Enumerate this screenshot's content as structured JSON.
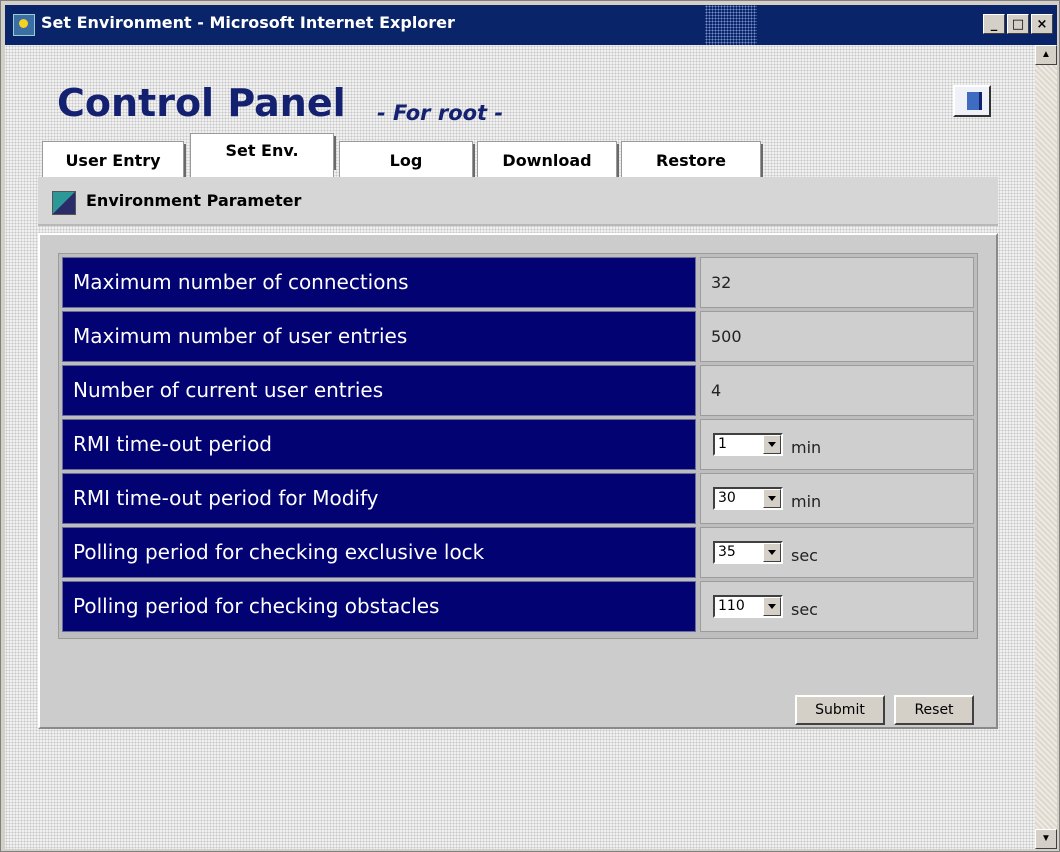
{
  "window": {
    "title": "Set Environment - Microsoft Internet Explorer",
    "controls": {
      "minimize": "_",
      "maximize": "□",
      "close": "×"
    }
  },
  "header": {
    "title": "Control Panel",
    "subtitle": "- For root -",
    "exit_icon": "exit-door-icon"
  },
  "tabs": [
    {
      "label": "User Entry",
      "active": false
    },
    {
      "label": "Set Env.",
      "active": true
    },
    {
      "label": "Log",
      "active": false
    },
    {
      "label": "Download",
      "active": false
    },
    {
      "label": "Restore",
      "active": false
    }
  ],
  "section": {
    "label": "Environment Parameter"
  },
  "params": [
    {
      "label": "Maximum number of connections",
      "value": "32"
    },
    {
      "label": "Maximum number of user entries",
      "value": "500"
    },
    {
      "label": "Number of current user entries",
      "value": "4"
    },
    {
      "label": "RMI time-out period",
      "value": "1",
      "unit": "min"
    },
    {
      "label": "RMI time-out period for Modify",
      "value": "30",
      "unit": "min"
    },
    {
      "label": "Polling period for checking exclusive lock",
      "value": "35",
      "unit": "sec"
    },
    {
      "label": "Polling period for checking obstacles",
      "value": "110",
      "unit": "sec"
    }
  ],
  "buttons": {
    "submit": "Submit",
    "reset": "Reset"
  },
  "scrollbar": {
    "up": "▲",
    "down": "▼"
  },
  "colors": {
    "label_bg": "#020273",
    "title": "#142170",
    "titlebar": "#0a246a"
  }
}
